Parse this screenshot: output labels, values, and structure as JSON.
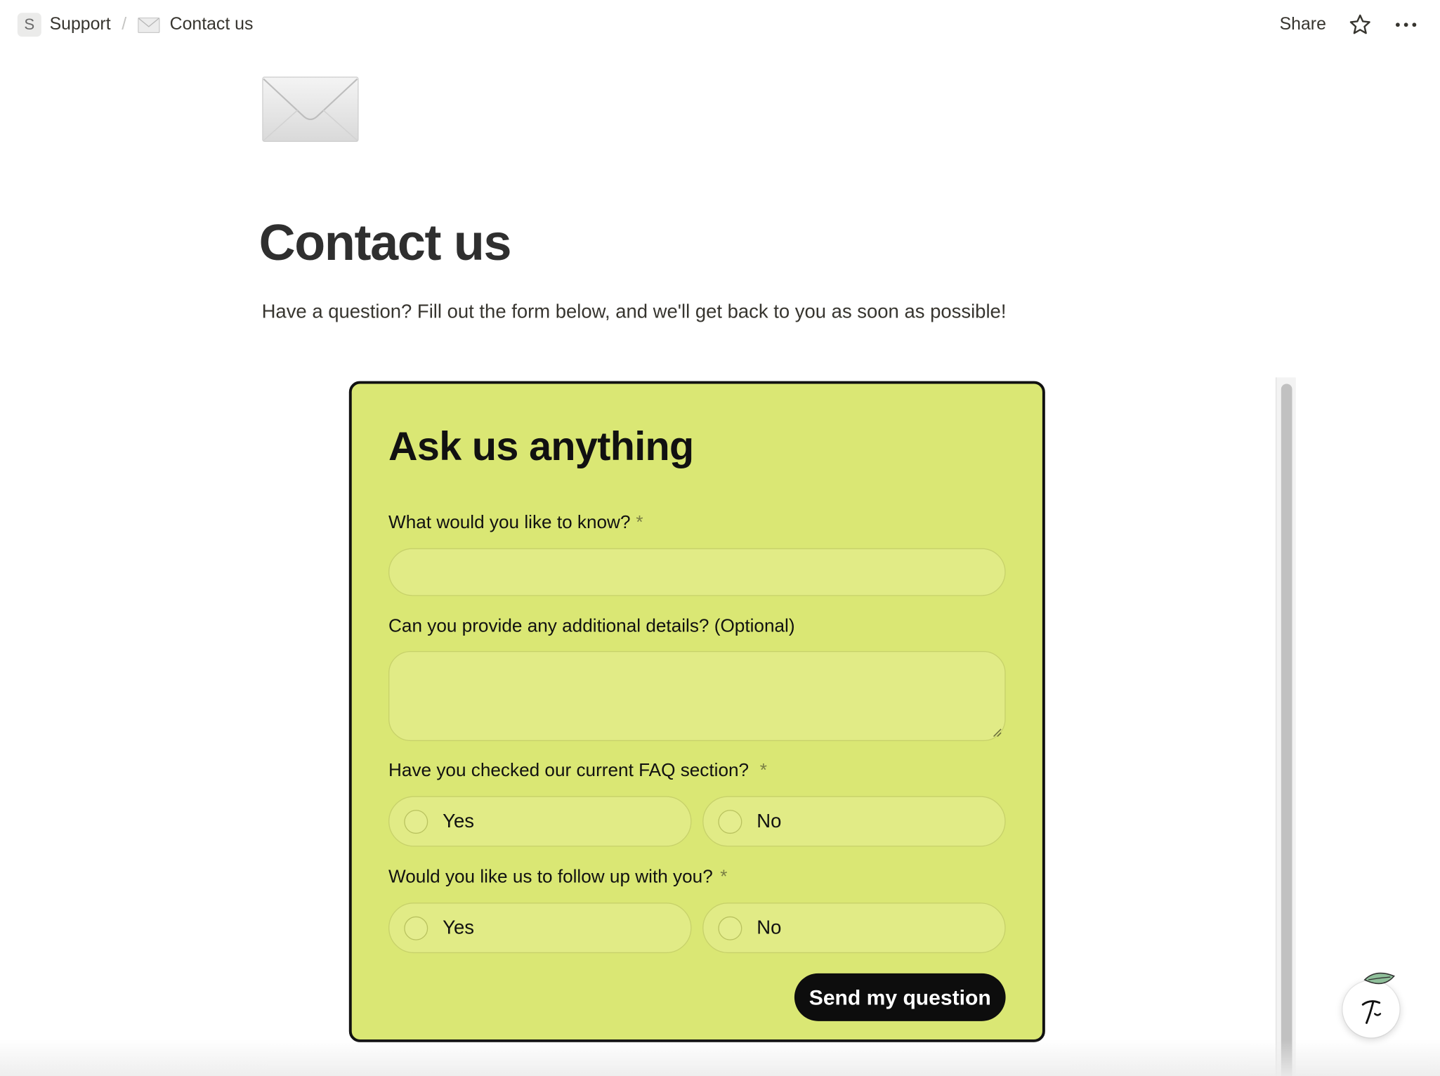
{
  "topbar": {
    "workspace_initial": "S",
    "breadcrumb_parent": "Support",
    "breadcrumb_separator": "/",
    "breadcrumb_current": "Contact us",
    "share_label": "Share"
  },
  "page": {
    "icon": "envelope-icon",
    "title": "Contact us",
    "description": "Have a question? Fill out the form below, and we'll get back to you as soon as possible!"
  },
  "form": {
    "heading": "Ask us anything",
    "background_color": "#dae774",
    "q1": {
      "label": "What would you like to know?",
      "required_mark": "*",
      "value": ""
    },
    "q2": {
      "label": "Can you provide any additional details? (Optional)",
      "value": ""
    },
    "q3": {
      "label": "Have you checked our current FAQ section?",
      "required_mark": "*",
      "options": [
        "Yes",
        "No"
      ]
    },
    "q4": {
      "label": "Would you like us to follow up with you?",
      "required_mark": "*",
      "options": [
        "Yes",
        "No"
      ]
    },
    "submit_label": "Send my question"
  },
  "colors": {
    "accent": "#dae774",
    "button": "#0d0d0d"
  }
}
